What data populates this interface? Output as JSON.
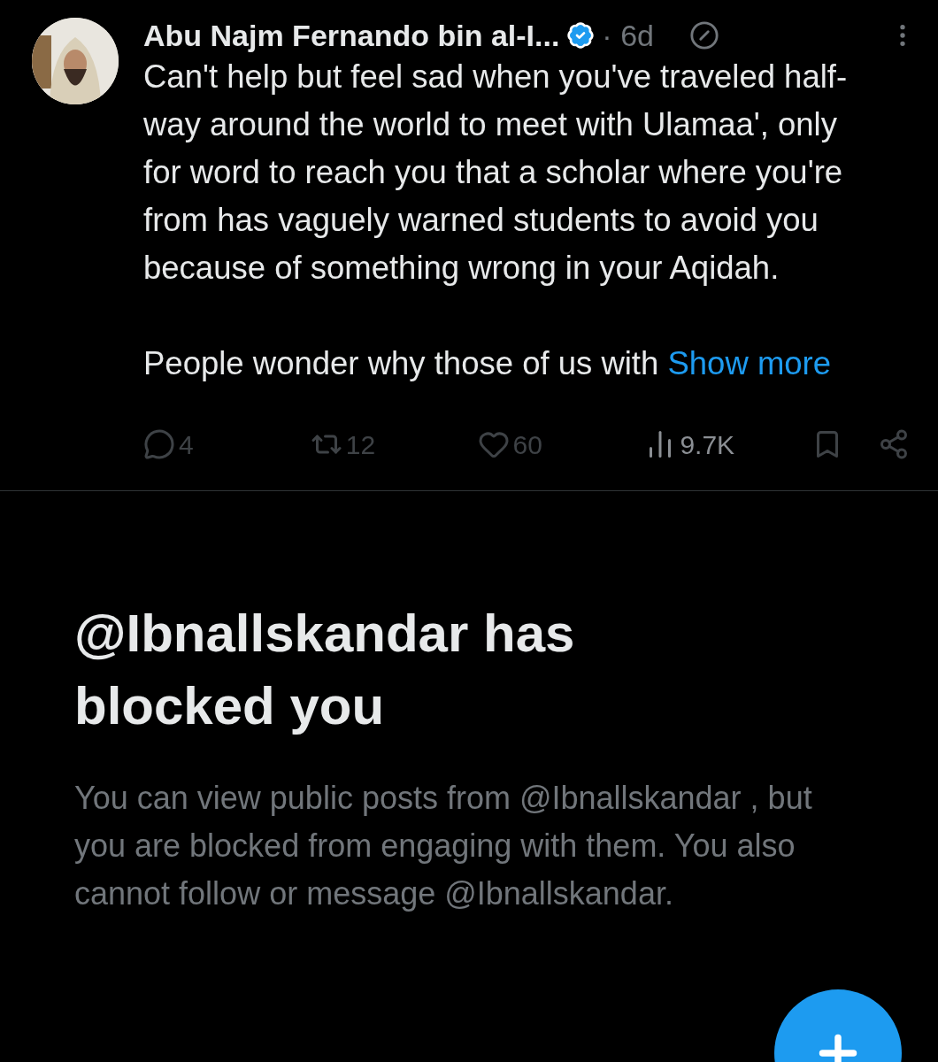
{
  "post": {
    "author": "Abu Najm Fernando bin al-I...",
    "verified": true,
    "time": "· 6d",
    "paragraphs": [
      "Can't help but feel sad when you've traveled half-way around the world to meet with Ulamaa', only for word to reach you that a scholar where you're from has vaguely warned students to avoid you because of something wrong in your Aqidah.",
      "People wonder why those of us with"
    ],
    "show_more": "Show more",
    "actions": [
      {
        "kind": "reply",
        "count": "4"
      },
      {
        "kind": "repost",
        "count": "12"
      },
      {
        "kind": "like",
        "count": "60"
      },
      {
        "kind": "views",
        "count": "9.7K"
      },
      {
        "kind": "bookmark"
      },
      {
        "kind": "share"
      }
    ]
  },
  "blocked": {
    "title": "@Ibnallskandar has blocked you",
    "message": "You can view public posts from @Ibnallskandar , but you are blocked from engaging with them. You also cannot follow or message @Ibnallskandar."
  }
}
